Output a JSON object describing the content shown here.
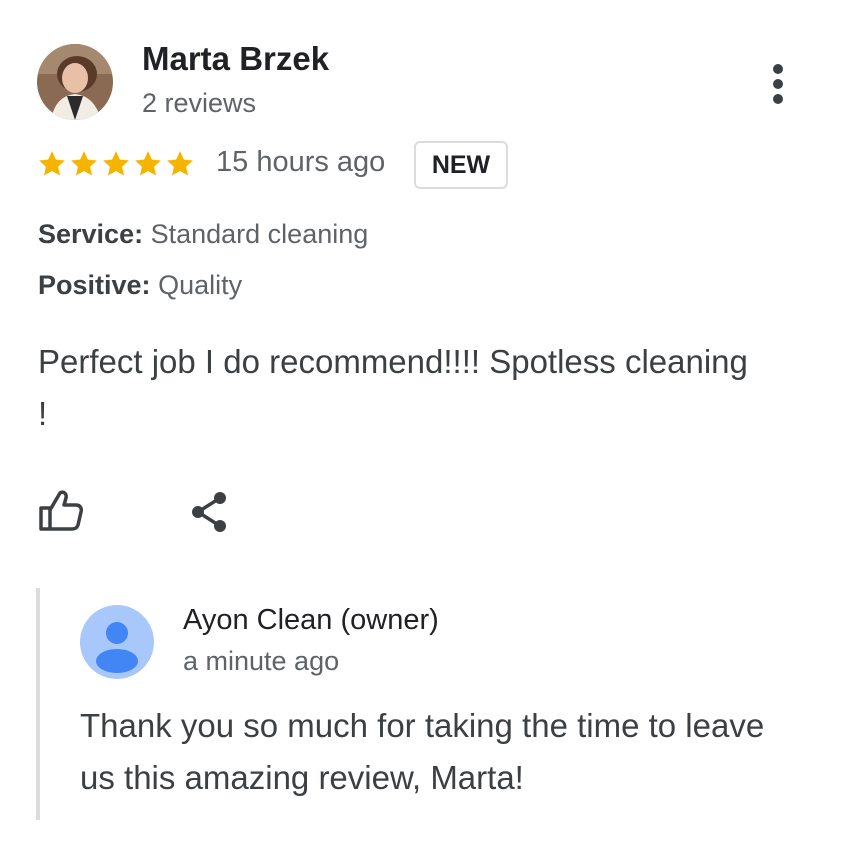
{
  "review": {
    "reviewer_name": "Marta Brzek",
    "reviewer_meta": "2 reviews",
    "rating": 5,
    "time_ago": "15 hours ago",
    "badge": "NEW",
    "attributes": [
      {
        "key": "Service:",
        "value": "Standard cleaning"
      },
      {
        "key": "Positive:",
        "value": "Quality"
      }
    ],
    "text": "Perfect job I do recommend!!!! Spotless cleaning !"
  },
  "reply": {
    "owner_name": "Ayon Clean (owner)",
    "time_ago": "a minute ago",
    "text": "Thank you so much for taking the time to leave us this amazing review, Marta!"
  },
  "icons": {
    "more": "more-vert-icon",
    "like": "thumbs-up-icon",
    "share": "share-icon",
    "star": "star-icon"
  },
  "colors": {
    "star": "#f4b400",
    "owner_avatar_bg": "#a8c7fa",
    "owner_avatar_fg": "#4285f4",
    "muted_text": "#5f6368",
    "border": "#dadce0"
  }
}
